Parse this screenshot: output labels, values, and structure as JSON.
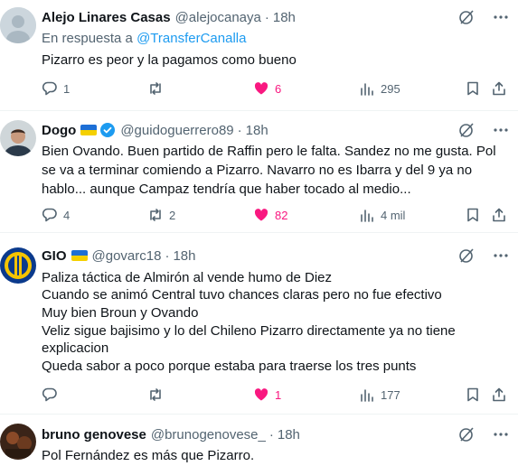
{
  "tweets": [
    {
      "name": "Alejo Linares Casas",
      "handle": "@alejocanaya",
      "time": "18h",
      "has_flag": false,
      "verified": false,
      "reply_prefix": "En respuesta a",
      "reply_handle": "@TransferCanalla",
      "lines": [
        "Pizarro es peor y la pagamos como bueno"
      ],
      "replies": "1",
      "retweets": "",
      "likes": "6",
      "liked": true,
      "views": "295"
    },
    {
      "name": "Dogo",
      "handle": "@guidoguerrero89",
      "time": "18h",
      "has_flag": true,
      "verified": true,
      "lines": [
        "Bien Ovando. Buen partido de Raffin pero le falta. Sandez no me gusta. Pol",
        "se va a terminar comiendo a Pizarro. Navarro no es Ibarra y del 9 ya no",
        "hablo... aunque Campaz tendría que haber tocado al medio..."
      ],
      "replies": "4",
      "retweets": "2",
      "likes": "82",
      "liked": true,
      "views": "4 mil"
    },
    {
      "name": "GIO",
      "handle": "@govarc18",
      "time": "18h",
      "has_flag": true,
      "verified": false,
      "lines": [
        "Paliza táctica de Almirón al vende humo de Diez",
        "Cuando se animó Central tuvo chances claras pero no fue efectivo",
        "Muy bien Broun y Ovando",
        "Veliz sigue bajisimo y lo del Chileno Pizarro directamente ya no tiene",
        "explicacion",
        "Queda sabor a poco porque estaba para traerse los tres punts"
      ],
      "replies": "",
      "retweets": "",
      "likes": "1",
      "liked": true,
      "views": "177"
    },
    {
      "name": "bruno genovese",
      "handle": "@brunogenovese_",
      "time": "18h",
      "has_flag": false,
      "verified": false,
      "lines": [
        "Pol Fernández es más que Pizarro."
      ]
    }
  ],
  "separator": "·",
  "colors": {
    "text": "#0f1419",
    "muted": "#536471",
    "link": "#1d9bf0",
    "like": "#f91880",
    "divider": "#eff3f4"
  },
  "icons": [
    "grok-icon",
    "more-icon",
    "reply-icon",
    "retweet-icon",
    "heart-icon",
    "views-icon",
    "bookmark-icon",
    "share-icon",
    "verified-badge-icon",
    "ukraine-flag-icon"
  ]
}
